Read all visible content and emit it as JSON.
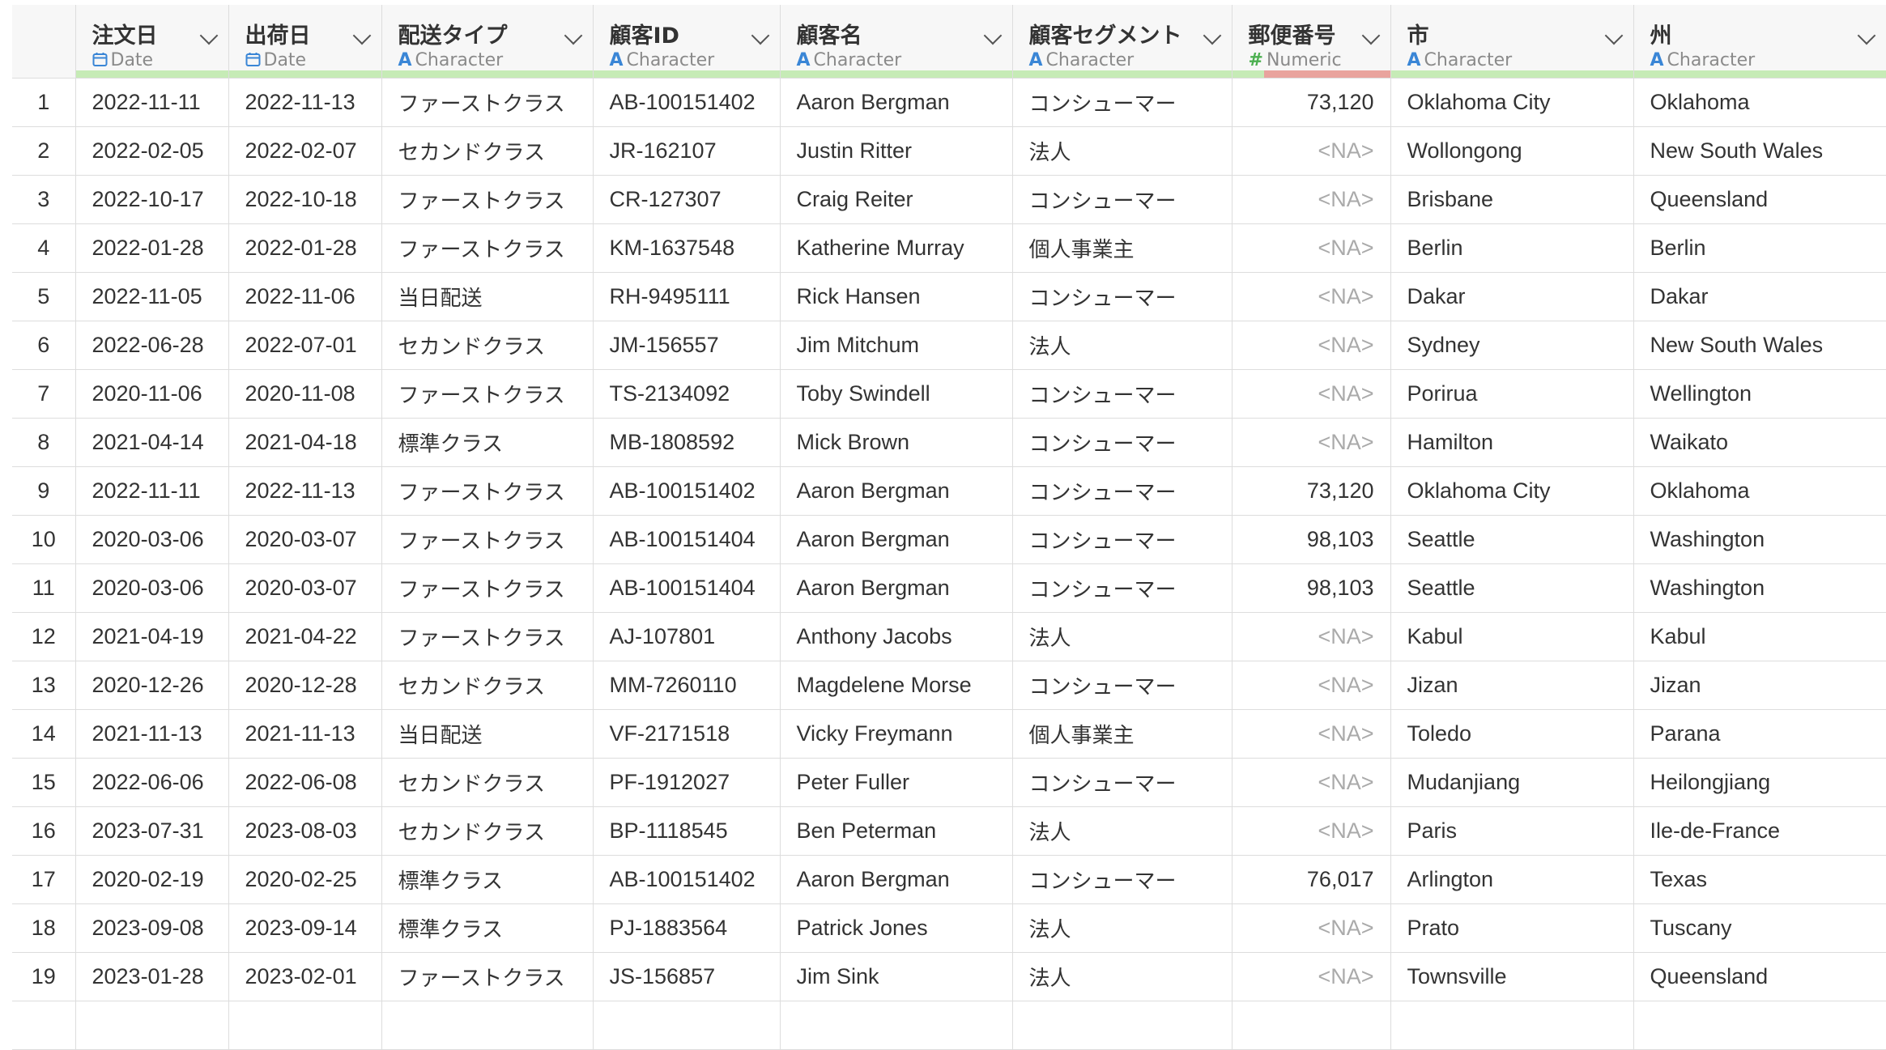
{
  "columns": [
    {
      "name": "注文日",
      "type": "Date",
      "type_icon": "calendar-icon"
    },
    {
      "name": "出荷日",
      "type": "Date",
      "type_icon": "calendar-icon"
    },
    {
      "name": "配送タイプ",
      "type": "Character",
      "type_icon": "character-A-icon"
    },
    {
      "name": "顧客ID",
      "type": "Character",
      "type_icon": "character-A-icon"
    },
    {
      "name": "顧客名",
      "type": "Character",
      "type_icon": "character-A-icon"
    },
    {
      "name": "顧客セグメント",
      "type": "Character",
      "type_icon": "character-A-icon"
    },
    {
      "name": "郵便番号",
      "type": "Numeric",
      "type_icon": "hash-icon"
    },
    {
      "name": "市",
      "type": "Character",
      "type_icon": "character-A-icon"
    },
    {
      "name": "州",
      "type": "Character",
      "type_icon": "character-A-icon"
    }
  ],
  "colors": {
    "type_icon_blue": "#3a86d6",
    "type_icon_green": "#4caf50",
    "quality_ok": "#c6ebb6",
    "quality_missing": "#e9a39d",
    "na_text": "#aaaaaa"
  },
  "rows": [
    {
      "idx": "1",
      "cells": [
        "2022-11-11",
        "2022-11-13",
        "ファーストクラス",
        "AB-100151402",
        "Aaron Bergman",
        "コンシューマー",
        "73,120",
        "Oklahoma City",
        "Oklahoma"
      ]
    },
    {
      "idx": "2",
      "cells": [
        "2022-02-05",
        "2022-02-07",
        "セカンドクラス",
        "JR-162107",
        "Justin Ritter",
        "法人",
        "<NA>",
        "Wollongong",
        "New South Wales"
      ]
    },
    {
      "idx": "3",
      "cells": [
        "2022-10-17",
        "2022-10-18",
        "ファーストクラス",
        "CR-127307",
        "Craig Reiter",
        "コンシューマー",
        "<NA>",
        "Brisbane",
        "Queensland"
      ]
    },
    {
      "idx": "4",
      "cells": [
        "2022-01-28",
        "2022-01-28",
        "ファーストクラス",
        "KM-1637548",
        "Katherine Murray",
        "個人事業主",
        "<NA>",
        "Berlin",
        "Berlin"
      ]
    },
    {
      "idx": "5",
      "cells": [
        "2022-11-05",
        "2022-11-06",
        "当日配送",
        "RH-9495111",
        "Rick Hansen",
        "コンシューマー",
        "<NA>",
        "Dakar",
        "Dakar"
      ]
    },
    {
      "idx": "6",
      "cells": [
        "2022-06-28",
        "2022-07-01",
        "セカンドクラス",
        "JM-156557",
        "Jim Mitchum",
        "法人",
        "<NA>",
        "Sydney",
        "New South Wales"
      ]
    },
    {
      "idx": "7",
      "cells": [
        "2020-11-06",
        "2020-11-08",
        "ファーストクラス",
        "TS-2134092",
        "Toby Swindell",
        "コンシューマー",
        "<NA>",
        "Porirua",
        "Wellington"
      ]
    },
    {
      "idx": "8",
      "cells": [
        "2021-04-14",
        "2021-04-18",
        "標準クラス",
        "MB-1808592",
        "Mick Brown",
        "コンシューマー",
        "<NA>",
        "Hamilton",
        "Waikato"
      ]
    },
    {
      "idx": "9",
      "cells": [
        "2022-11-11",
        "2022-11-13",
        "ファーストクラス",
        "AB-100151402",
        "Aaron Bergman",
        "コンシューマー",
        "73,120",
        "Oklahoma City",
        "Oklahoma"
      ]
    },
    {
      "idx": "10",
      "cells": [
        "2020-03-06",
        "2020-03-07",
        "ファーストクラス",
        "AB-100151404",
        "Aaron Bergman",
        "コンシューマー",
        "98,103",
        "Seattle",
        "Washington"
      ]
    },
    {
      "idx": "11",
      "cells": [
        "2020-03-06",
        "2020-03-07",
        "ファーストクラス",
        "AB-100151404",
        "Aaron Bergman",
        "コンシューマー",
        "98,103",
        "Seattle",
        "Washington"
      ]
    },
    {
      "idx": "12",
      "cells": [
        "2021-04-19",
        "2021-04-22",
        "ファーストクラス",
        "AJ-107801",
        "Anthony Jacobs",
        "法人",
        "<NA>",
        "Kabul",
        "Kabul"
      ]
    },
    {
      "idx": "13",
      "cells": [
        "2020-12-26",
        "2020-12-28",
        "セカンドクラス",
        "MM-7260110",
        "Magdelene Morse",
        "コンシューマー",
        "<NA>",
        "Jizan",
        "Jizan"
      ]
    },
    {
      "idx": "14",
      "cells": [
        "2021-11-13",
        "2021-11-13",
        "当日配送",
        "VF-2171518",
        "Vicky Freymann",
        "個人事業主",
        "<NA>",
        "Toledo",
        "Parana"
      ]
    },
    {
      "idx": "15",
      "cells": [
        "2022-06-06",
        "2022-06-08",
        "セカンドクラス",
        "PF-1912027",
        "Peter Fuller",
        "コンシューマー",
        "<NA>",
        "Mudanjiang",
        "Heilongjiang"
      ]
    },
    {
      "idx": "16",
      "cells": [
        "2023-07-31",
        "2023-08-03",
        "セカンドクラス",
        "BP-1118545",
        "Ben Peterman",
        "法人",
        "<NA>",
        "Paris",
        "Ile-de-France"
      ]
    },
    {
      "idx": "17",
      "cells": [
        "2020-02-19",
        "2020-02-25",
        "標準クラス",
        "AB-100151402",
        "Aaron Bergman",
        "コンシューマー",
        "76,017",
        "Arlington",
        "Texas"
      ]
    },
    {
      "idx": "18",
      "cells": [
        "2023-09-08",
        "2023-09-14",
        "標準クラス",
        "PJ-1883564",
        "Patrick Jones",
        "法人",
        "<NA>",
        "Prato",
        "Tuscany"
      ]
    },
    {
      "idx": "19",
      "cells": [
        "2023-01-28",
        "2023-02-01",
        "ファーストクラス",
        "JS-156857",
        "Jim Sink",
        "法人",
        "<NA>",
        "Townsville",
        "Queensland"
      ]
    },
    {
      "idx": "",
      "cells": [
        "",
        "",
        "",
        "",
        "",
        "",
        "",
        "",
        ""
      ]
    }
  ]
}
